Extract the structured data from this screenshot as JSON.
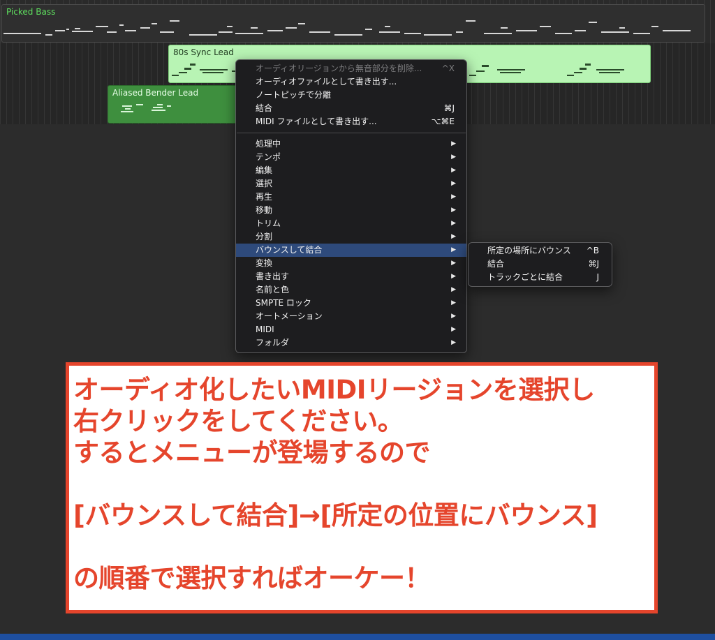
{
  "tracks": {
    "regions": [
      {
        "name": "Picked Bass"
      },
      {
        "name": "80s Sync Lead"
      },
      {
        "name": "Aliased Bender Lead"
      }
    ]
  },
  "context_menu": {
    "items": [
      {
        "label": "オーディオリージョンから無音部分を削除...",
        "shortcut": "^X",
        "disabled": true
      },
      {
        "label": "オーディオファイルとして書き出す...",
        "shortcut": ""
      },
      {
        "label": "ノートピッチで分離",
        "shortcut": ""
      },
      {
        "label": "結合",
        "shortcut": "⌘J"
      },
      {
        "label": "MIDI ファイルとして書き出す...",
        "shortcut": "⌥⌘E"
      }
    ],
    "submenus": [
      {
        "label": "処理中"
      },
      {
        "label": "テンポ"
      },
      {
        "label": "編集"
      },
      {
        "label": "選択"
      },
      {
        "label": "再生"
      },
      {
        "label": "移動"
      },
      {
        "label": "トリム"
      },
      {
        "label": "分割"
      },
      {
        "label": "バウンスして結合",
        "highlighted": true
      },
      {
        "label": "変換"
      },
      {
        "label": "書き出す"
      },
      {
        "label": "名前と色"
      },
      {
        "label": "SMPTE ロック"
      },
      {
        "label": "オートメーション"
      },
      {
        "label": "MIDI"
      },
      {
        "label": "フォルダ"
      }
    ]
  },
  "bounce_submenu": {
    "items": [
      {
        "label": "所定の場所にバウンス",
        "shortcut": "^B"
      },
      {
        "label": "結合",
        "shortcut": "⌘J"
      },
      {
        "label": "トラックごとに結合",
        "shortcut": "J"
      }
    ]
  },
  "instruction": {
    "lines": [
      "オーディオ化したいMIDIリージョンを選択し",
      "右クリックをしてください。",
      "するとメニューが登場するので",
      "",
      "[バウンスして結合]→[所定の位置にバウンス]",
      "",
      "の順番で選択すればオーケー！"
    ]
  },
  "colors": {
    "accent_red": "#e5452c",
    "menu_highlight": "#2e4a7b",
    "region_light_green": "#b8f4b4",
    "region_dark_green": "#3e8f3e",
    "track_label_green": "#5fe05f"
  }
}
